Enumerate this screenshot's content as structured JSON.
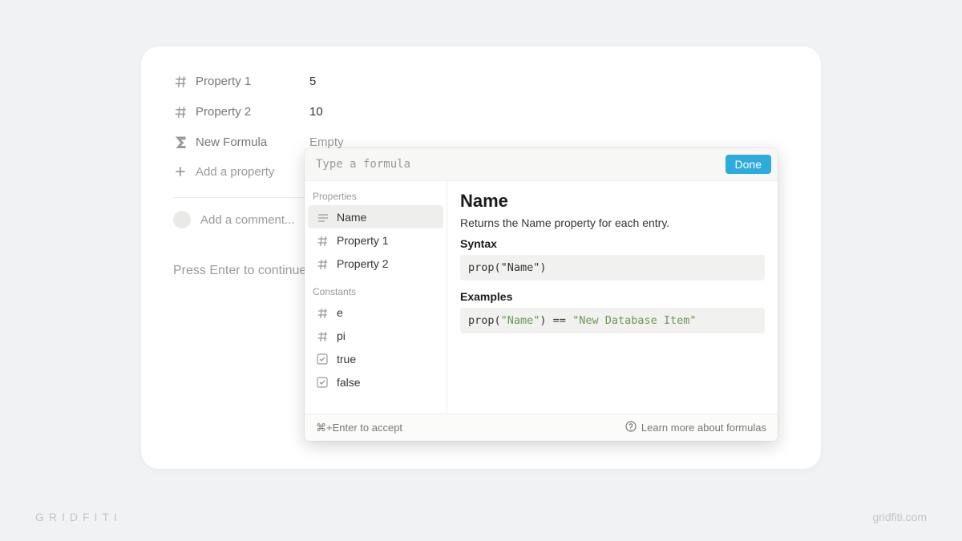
{
  "properties": [
    {
      "icon": "hash",
      "name": "Property 1",
      "value": "5"
    },
    {
      "icon": "hash",
      "name": "Property 2",
      "value": "10"
    },
    {
      "icon": "sigma",
      "name": "New Formula",
      "value": "Empty",
      "empty": true
    }
  ],
  "add_property_label": "Add a property",
  "comment_placeholder": "Add a comment...",
  "continue_hint": "Press Enter to continue",
  "popover": {
    "input_placeholder": "Type a formula",
    "done_label": "Done",
    "sections": {
      "properties_label": "Properties",
      "properties": [
        {
          "icon": "text",
          "label": "Name"
        },
        {
          "icon": "hash",
          "label": "Property 1"
        },
        {
          "icon": "hash",
          "label": "Property 2"
        }
      ],
      "constants_label": "Constants",
      "constants": [
        {
          "icon": "hash",
          "label": "e"
        },
        {
          "icon": "hash",
          "label": "pi"
        },
        {
          "icon": "check",
          "label": "true"
        },
        {
          "icon": "check",
          "label": "false"
        }
      ]
    },
    "detail": {
      "title": "Name",
      "description": "Returns the Name property for each entry.",
      "syntax_label": "Syntax",
      "syntax_code": "prop(\"Name\")",
      "examples_label": "Examples",
      "example_tokens": [
        {
          "t": "prop(",
          "c": ""
        },
        {
          "t": "\"Name\"",
          "c": "str"
        },
        {
          "t": ") == ",
          "c": ""
        },
        {
          "t": "\"New Database Item\"",
          "c": "str"
        }
      ]
    },
    "footer": {
      "accept_hint": "⌘+Enter to accept",
      "learn_more": "Learn more about formulas"
    }
  },
  "watermark": {
    "left": "GRIDFITI",
    "right": "gridfiti.com"
  }
}
